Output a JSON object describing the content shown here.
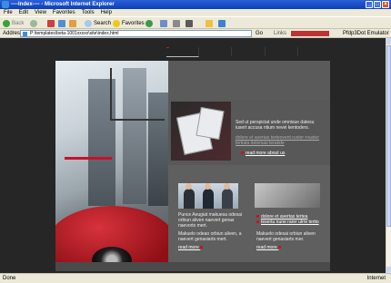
{
  "window": {
    "title": "----Index---- - Microsoft Internet Explorer"
  },
  "menu": [
    "File",
    "Edit",
    "View",
    "Favorites",
    "Tools",
    "Help"
  ],
  "toolbar": {
    "back": "Back",
    "search": "Search",
    "favorites": "Favorites"
  },
  "address": {
    "label": "Address",
    "value": "P:\\templates\\beta-1001xxxxx\\site\\index.html",
    "go": "Go",
    "links": "Links",
    "emulator": "Pfdp3Dot Emulator"
  },
  "status": {
    "left": "Done",
    "right": "Internet"
  },
  "page": {
    "promo_text": "Sed ut perspiciat unde omnisue datesu iusert accusa ntium nevei kentoders.",
    "promo_links": "dolore et avertas terteovent ruster rouster tertiata deleriuai terakde",
    "promo_more": "read more about us",
    "card1_text1": "Punce Aeugiat makuesa odesai orbiun aliven naevert genas naevorts mert.",
    "card1_text2": "Makuelo odeao orbiun aliven, a naevert genasiarts mert.",
    "card1_more": "read more",
    "card2_link1": "dolore et avertas tertea",
    "card2_link2": "tesertu nune rarer ulrre tertio",
    "card2_text": "Makuelo odesai orbiun aliven naevert genasiarts mer.",
    "card2_more": "read more"
  }
}
